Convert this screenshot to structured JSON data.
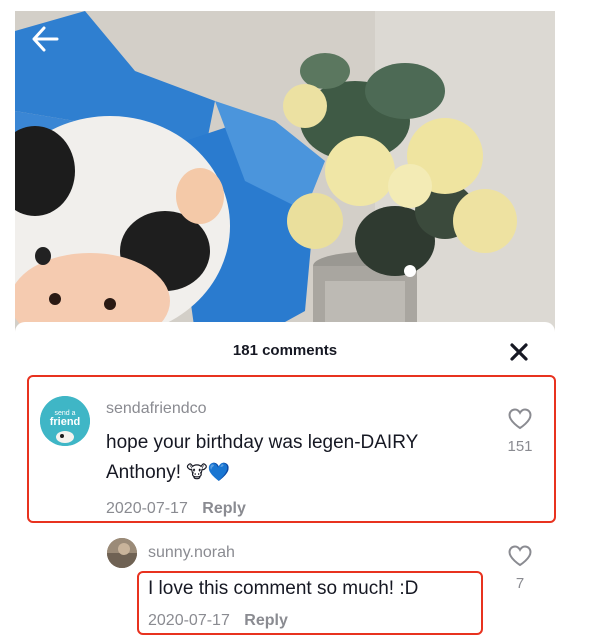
{
  "header": {
    "comments_count": "181 comments"
  },
  "comments": [
    {
      "username": "sendafriendco",
      "avatar_text": "send a friend",
      "text_line1": "hope your birthday was legen-DAIRY",
      "text_line2": "Anthony!",
      "emoji": "🐮💙",
      "date": "2020-07-17",
      "reply_label": "Reply",
      "likes": "151"
    },
    {
      "username": "sunny.norah",
      "text": "I love this comment so much! :D",
      "date": "2020-07-17",
      "reply_label": "Reply",
      "likes": "7"
    }
  ],
  "icons": {
    "back": "arrow-left-icon",
    "close": "close-icon",
    "like": "heart-outline-icon"
  },
  "colors": {
    "highlight": "#e8321f",
    "text_primary": "#161823",
    "text_secondary": "#8a8b91",
    "avatar_teal": "#3fb6c6"
  }
}
